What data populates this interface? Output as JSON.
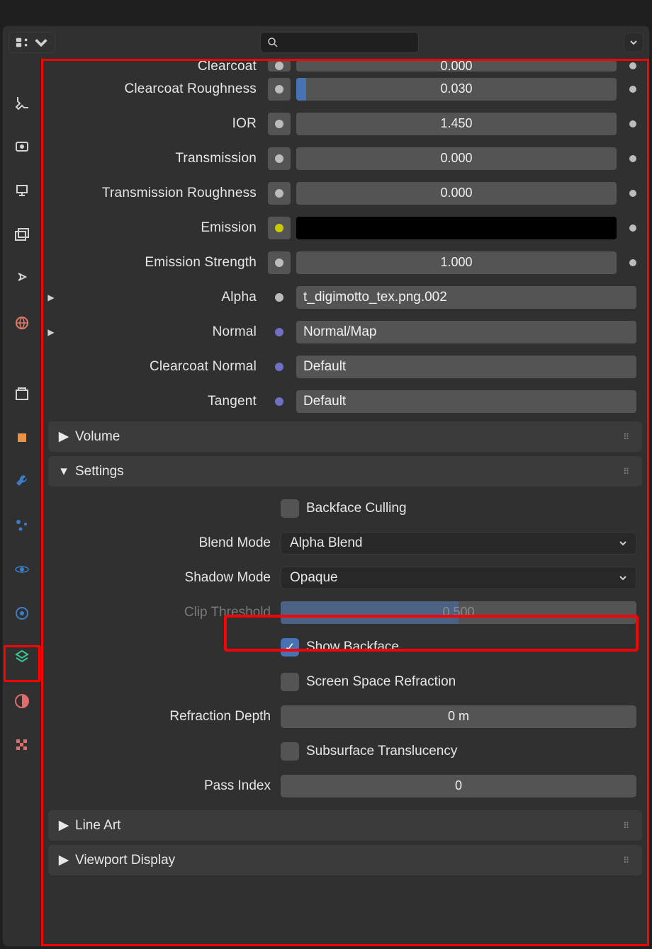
{
  "shader": {
    "clearcoat": {
      "label": "Clearcoat",
      "value": "0.000"
    },
    "clearcoat_roughness": {
      "label": "Clearcoat Roughness",
      "value": "0.030",
      "fill": 3
    },
    "ior": {
      "label": "IOR",
      "value": "1.450"
    },
    "transmission": {
      "label": "Transmission",
      "value": "0.000"
    },
    "transmission_roughness": {
      "label": "Transmission Roughness",
      "value": "0.000"
    },
    "emission": {
      "label": "Emission"
    },
    "emission_strength": {
      "label": "Emission Strength",
      "value": "1.000"
    },
    "alpha": {
      "label": "Alpha",
      "value": "t_digimotto_tex.png.002"
    },
    "normal": {
      "label": "Normal",
      "value": "Normal/Map"
    },
    "clearcoat_normal": {
      "label": "Clearcoat Normal",
      "value": "Default"
    },
    "tangent": {
      "label": "Tangent",
      "value": "Default"
    }
  },
  "sections": {
    "volume": "Volume",
    "settings": "Settings",
    "line_art": "Line Art",
    "viewport_display": "Viewport Display"
  },
  "settings": {
    "backface_culling": {
      "label": "Backface Culling",
      "checked": false
    },
    "blend_mode": {
      "label": "Blend Mode",
      "value": "Alpha Blend"
    },
    "shadow_mode": {
      "label": "Shadow Mode",
      "value": "Opaque"
    },
    "clip_threshold": {
      "label": "Clip Threshold",
      "value": "0.500",
      "fill": 50
    },
    "show_backface": {
      "label": "Show Backface",
      "checked": true
    },
    "ssr": {
      "label": "Screen Space Refraction",
      "checked": false
    },
    "refraction_depth": {
      "label": "Refraction Depth",
      "value": "0 m"
    },
    "sss": {
      "label": "Subsurface Translucency",
      "checked": false
    },
    "pass_index": {
      "label": "Pass Index",
      "value": "0"
    }
  }
}
